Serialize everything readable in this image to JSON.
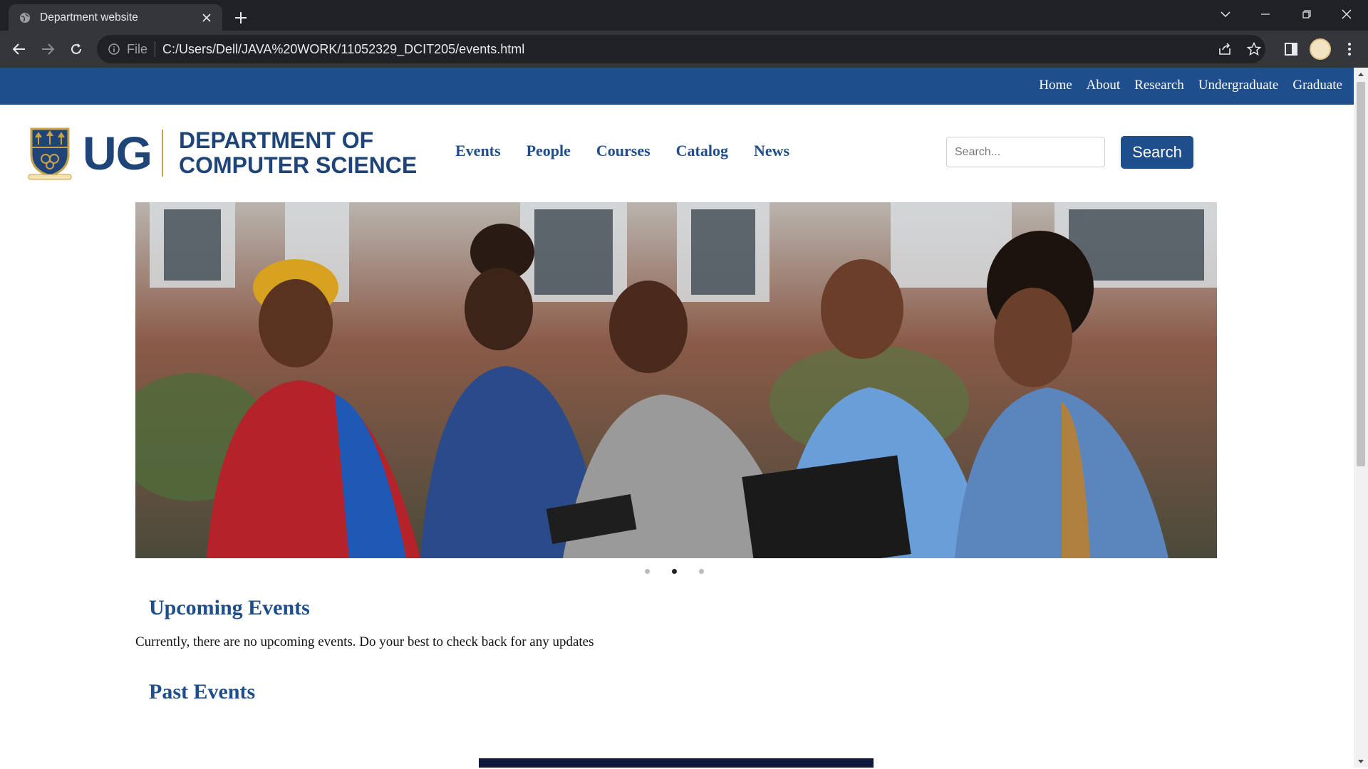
{
  "browser": {
    "tab_title": "Department website",
    "omnibox_scheme": "File",
    "url": "C:/Users/Dell/JAVA%20WORK/11052329_DCIT205/events.html"
  },
  "site": {
    "top_nav": [
      "Home",
      "About",
      "Research",
      "Undergraduate",
      "Graduate"
    ],
    "logo_text": "UG",
    "dept_line1": "DEPARTMENT OF",
    "dept_line2": "COMPUTER SCIENCE",
    "main_nav": [
      "Events",
      "People",
      "Courses",
      "Catalog",
      "News"
    ],
    "search": {
      "placeholder": "Search...",
      "button": "Search"
    },
    "carousel": {
      "slides": 3,
      "active_index": 1
    }
  },
  "content": {
    "upcoming_heading": "Upcoming Events",
    "upcoming_text": "Currently, there are no upcoming events. Do your best to check back for any updates",
    "past_heading": "Past Events"
  },
  "colors": {
    "brand_blue": "#1f4e8c",
    "logo_navy": "#1f4578",
    "gold": "#c8a24a"
  }
}
